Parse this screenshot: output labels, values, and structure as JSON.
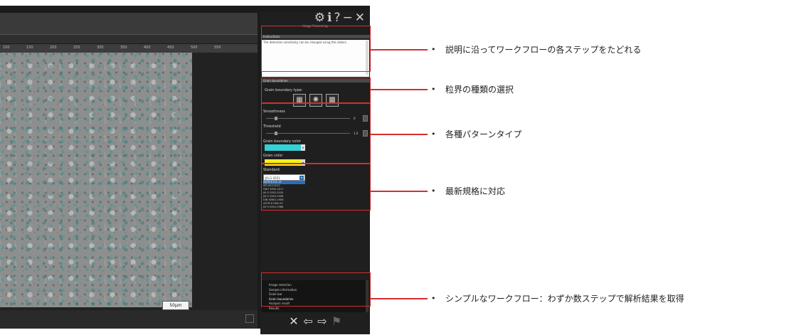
{
  "app": {
    "title_icons": [
      "gear-icon",
      "info-icon",
      "help-icon",
      "minimize-icon",
      "close-icon"
    ],
    "topicons_text": "⚙ℹ?−✕",
    "panel_title": "Image Processing",
    "scale_label": "50μm",
    "ruler_ticks": [
      "100",
      "150",
      "200",
      "250",
      "300",
      "350",
      "400",
      "450",
      "500",
      "550"
    ]
  },
  "instructions": {
    "header": "Instructions",
    "text": "The detection sensitivity can be changed using the sliders."
  },
  "grain_boundary": {
    "header": "Grain boundaries",
    "label": "Grain boundary type:"
  },
  "parameters": {
    "smoothness_label": "Smoothness",
    "smoothness_value": "0",
    "threshold_label": "Threshold",
    "threshold_value": "1.0",
    "gb_color_label": "Grain boundary color",
    "grain_color_label": "Grain color",
    "gb_color": "#34d1d6",
    "grain_color": "#f2f21a"
  },
  "standard": {
    "header": "Standard",
    "selected": "JIS G 0551",
    "options": [
      "ASTM E112-13",
      "ISO 643:2012",
      "GB/T 6394-2017",
      "JIS G 0551:2020",
      "JIS G 0552:1998",
      "DIN 50601:1985",
      "ASTM E1382-97",
      "JIS H 0501:1986"
    ]
  },
  "workflow": {
    "items": [
      "Image selection",
      "Sample information",
      "Scale bar",
      "Grain boundaries",
      "Analysis result",
      "Results"
    ]
  },
  "nav": {
    "close": "✕",
    "back": "⇦",
    "next": "⇨",
    "finish": "⚑"
  },
  "annotations": [
    "説明に沿ってワークフローの各ステップをたどれる",
    "粒界の種類の選択",
    "各種パターンタイプ",
    "最新規格に対応",
    "シンプルなワークフロー：わずか数ステップで解析結果を取得"
  ],
  "colors": {
    "highlight": "#d32f2f",
    "panel_bg": "#1f1f1f",
    "accent_blue": "#2c6db3"
  }
}
